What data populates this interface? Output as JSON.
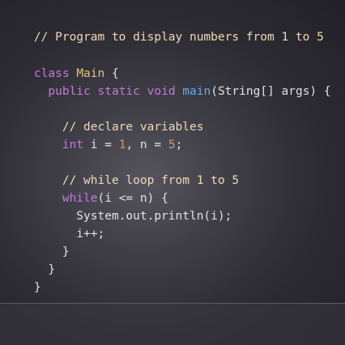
{
  "code": {
    "line1": {
      "comment": "// Program to display numbers from 1 to 5"
    },
    "line3": {
      "kw": "class",
      "name": "Main",
      "brace": " {"
    },
    "line4": {
      "indent": "  ",
      "kw1": "public",
      "kw2": "static",
      "kw3": "void",
      "fn": "main",
      "rest": "(String[] args) {"
    },
    "line6": {
      "indent": "    ",
      "comment": "// declare variables"
    },
    "line7": {
      "indent": "    ",
      "kw": "int",
      "p1": " i = ",
      "n1": "1",
      "p2": ", n = ",
      "n2": "5",
      "p3": ";"
    },
    "line9": {
      "indent": "    ",
      "comment": "// while loop from 1 to 5"
    },
    "line10": {
      "indent": "    ",
      "kw": "while",
      "rest": "(i <= n) {"
    },
    "line11": {
      "text": "      System.out.println(i);"
    },
    "line12": {
      "text": "      i++;"
    },
    "line13": {
      "text": "    }"
    },
    "line14": {
      "text": "  }"
    },
    "line15": {
      "text": "}"
    }
  },
  "colors": {
    "comment": "#f0d9b6",
    "keyword": "#c678dd",
    "class_name": "#e5c07b",
    "function": "#61afef",
    "number": "#d19a66",
    "text": "#e2e2e2"
  }
}
